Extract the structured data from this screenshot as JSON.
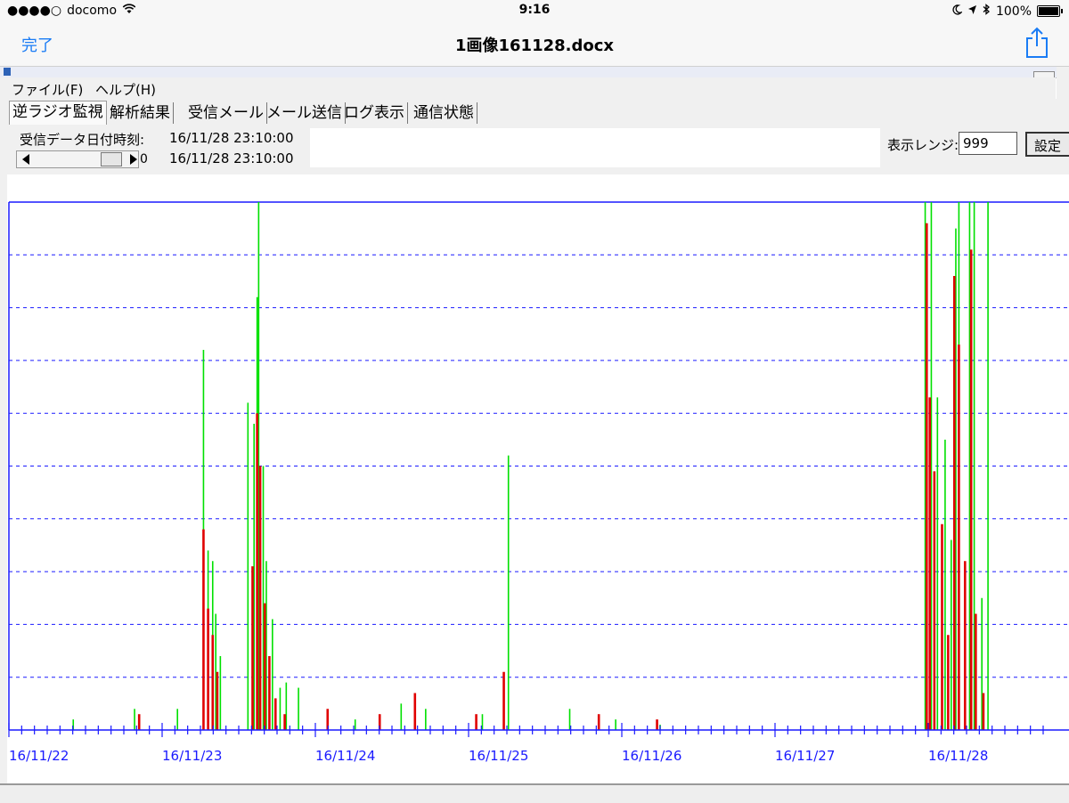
{
  "status_bar": {
    "carrier": "docomo",
    "time": "9:16",
    "battery": "100%",
    "signal": "●●●●○"
  },
  "nav": {
    "done_label": "完了",
    "title": "1画像161128.docx"
  },
  "window": {
    "menu": [
      "ファイル(F)",
      "ヘルプ(H)"
    ],
    "tabs": [
      "逆ラジオ監視",
      "解析結果",
      "受信メール",
      "メール送信",
      "ログ表示",
      "通信状態"
    ],
    "active_tab": 0,
    "toolbar": {
      "received_label": "受信データ日付時刻:",
      "received_time": "16/11/28 23:10:00",
      "slider_time": "16/11/28 23:10:00",
      "slider_value": "0",
      "range_label": "表示レンジ:",
      "range_value": "999",
      "set_button": "設定"
    }
  },
  "colors": {
    "ios_blue": "#1a7cf5",
    "axis_blue": "#1a1aff",
    "series_green": "#00e000",
    "series_red": "#e00000"
  },
  "chart_data": {
    "type": "bar",
    "title": "",
    "xlabel": "",
    "ylabel": "",
    "x_tick_labels": [
      "16/11/22",
      "16/11/23",
      "16/11/24",
      "16/11/25",
      "16/11/26",
      "16/11/27",
      "16/11/28"
    ],
    "x_range_days": [
      0,
      6.8
    ],
    "ylim": [
      0,
      10
    ],
    "y_gridlines": 10,
    "grid": true,
    "series": [
      {
        "color": "#00e000",
        "points": [
          [
            0.42,
            0.2
          ],
          [
            0.82,
            0.4
          ],
          [
            1.1,
            0.4
          ],
          [
            1.27,
            7.2
          ],
          [
            1.3,
            3.4
          ],
          [
            1.33,
            3.2
          ],
          [
            1.35,
            2.2
          ],
          [
            1.38,
            1.4
          ],
          [
            1.56,
            6.2
          ],
          [
            1.6,
            5.8
          ],
          [
            1.62,
            8.2
          ],
          [
            1.63,
            10
          ],
          [
            1.66,
            5
          ],
          [
            1.68,
            3.2
          ],
          [
            1.72,
            2.1
          ],
          [
            1.77,
            0.8
          ],
          [
            1.81,
            0.9
          ],
          [
            1.89,
            0.8
          ],
          [
            2.26,
            0.2
          ],
          [
            2.56,
            0.5
          ],
          [
            2.72,
            0.4
          ],
          [
            3.09,
            0.3
          ],
          [
            3.26,
            5.2
          ],
          [
            3.66,
            0.4
          ],
          [
            3.96,
            0.2
          ],
          [
            4.25,
            0.1
          ],
          [
            5.98,
            10
          ],
          [
            6.02,
            10
          ],
          [
            6.06,
            6.3
          ],
          [
            6.11,
            5.5
          ],
          [
            6.15,
            3.6
          ],
          [
            6.18,
            9.5
          ],
          [
            6.2,
            10
          ],
          [
            6.27,
            10
          ],
          [
            6.3,
            10
          ],
          [
            6.35,
            2.5
          ],
          [
            6.39,
            10
          ]
        ]
      },
      {
        "color": "#e00000",
        "points": [
          [
            0.85,
            0.3
          ],
          [
            1.27,
            3.8
          ],
          [
            1.3,
            2.3
          ],
          [
            1.33,
            1.8
          ],
          [
            1.36,
            1.1
          ],
          [
            1.59,
            3.1
          ],
          [
            1.62,
            6
          ],
          [
            1.64,
            5
          ],
          [
            1.67,
            2.4
          ],
          [
            1.7,
            1.4
          ],
          [
            1.74,
            0.6
          ],
          [
            1.8,
            0.3
          ],
          [
            2.08,
            0.4
          ],
          [
            2.42,
            0.3
          ],
          [
            2.65,
            0.7
          ],
          [
            3.05,
            0.3
          ],
          [
            3.23,
            1.1
          ],
          [
            3.85,
            0.3
          ],
          [
            4.23,
            0.2
          ],
          [
            5.99,
            9.6
          ],
          [
            6.01,
            6.3
          ],
          [
            6.04,
            4.9
          ],
          [
            6.09,
            3.9
          ],
          [
            6.13,
            1.8
          ],
          [
            6.17,
            8.6
          ],
          [
            6.2,
            7.3
          ],
          [
            6.24,
            3.2
          ],
          [
            6.28,
            9.1
          ],
          [
            6.31,
            2.2
          ],
          [
            6.36,
            0.7
          ]
        ]
      }
    ]
  }
}
